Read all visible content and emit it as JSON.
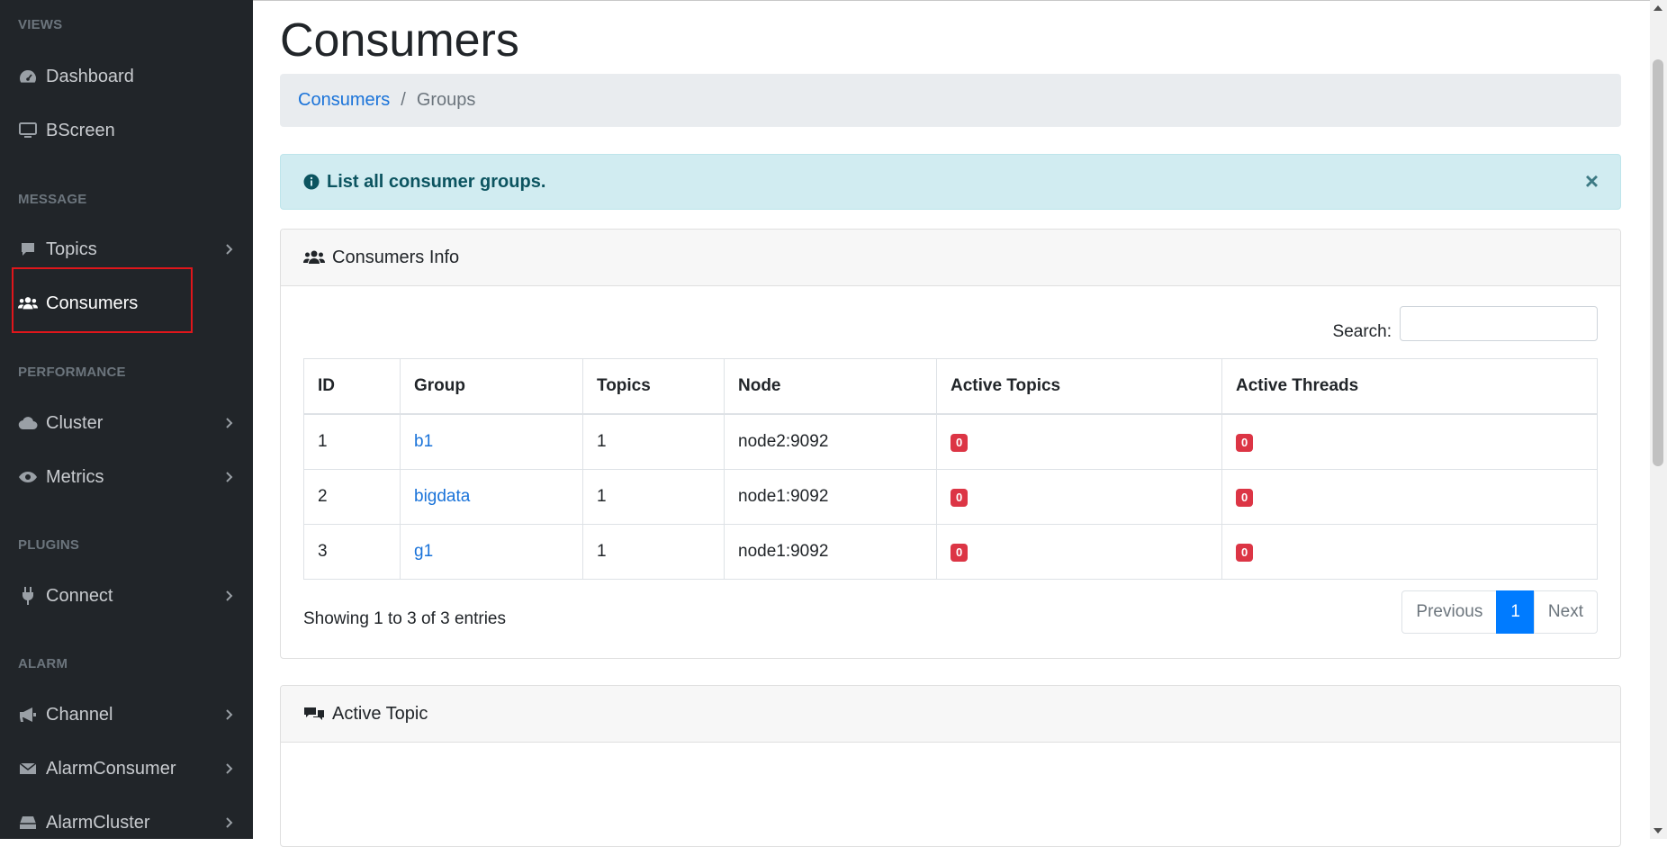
{
  "sidebar": {
    "headings": [
      "VIEWS",
      "MESSAGE",
      "PERFORMANCE",
      "PLUGINS",
      "ALARM"
    ],
    "items": [
      {
        "label": "Dashboard",
        "icon": "dashboard-icon"
      },
      {
        "label": "BScreen",
        "icon": "monitor-icon"
      },
      {
        "label": "Topics",
        "icon": "comment-icon"
      },
      {
        "label": "Consumers",
        "icon": "users-icon",
        "active": true
      },
      {
        "label": "Cluster",
        "icon": "cloud-icon"
      },
      {
        "label": "Metrics",
        "icon": "eye-icon"
      },
      {
        "label": "Connect",
        "icon": "plug-icon"
      },
      {
        "label": "Channel",
        "icon": "bullhorn-icon"
      },
      {
        "label": "AlarmConsumer",
        "icon": "envelope-icon"
      },
      {
        "label": "AlarmCluster",
        "icon": "hdd-icon"
      }
    ]
  },
  "page": {
    "title": "Consumers",
    "breadcrumb": {
      "link": "Consumers",
      "separator": "/",
      "current": "Groups"
    },
    "alert": {
      "text": "List all consumer groups.",
      "close": "×"
    }
  },
  "consumers_card": {
    "title": "Consumers Info",
    "search_label": "Search:",
    "search_value": "",
    "columns": [
      "ID",
      "Group",
      "Topics",
      "Node",
      "Active Topics",
      "Active Threads"
    ],
    "rows": [
      {
        "id": "1",
        "group": "b1",
        "topics": "1",
        "node": "node2:9092",
        "active_topics": "0",
        "active_threads": "0"
      },
      {
        "id": "2",
        "group": "bigdata",
        "topics": "1",
        "node": "node1:9092",
        "active_topics": "0",
        "active_threads": "0"
      },
      {
        "id": "3",
        "group": "g1",
        "topics": "1",
        "node": "node1:9092",
        "active_topics": "0",
        "active_threads": "0"
      }
    ],
    "info": "Showing 1 to 3 of 3 entries",
    "pagination": {
      "previous": "Previous",
      "current": "1",
      "next": "Next"
    }
  },
  "active_topic_card": {
    "title": "Active Topic"
  },
  "colors": {
    "sidebar_bg": "#212529",
    "link": "#1a73d9",
    "badge": "#dc3545",
    "alert_bg": "#d1ecf1",
    "page_active": "#007bff",
    "highlight": "#e0161b"
  }
}
